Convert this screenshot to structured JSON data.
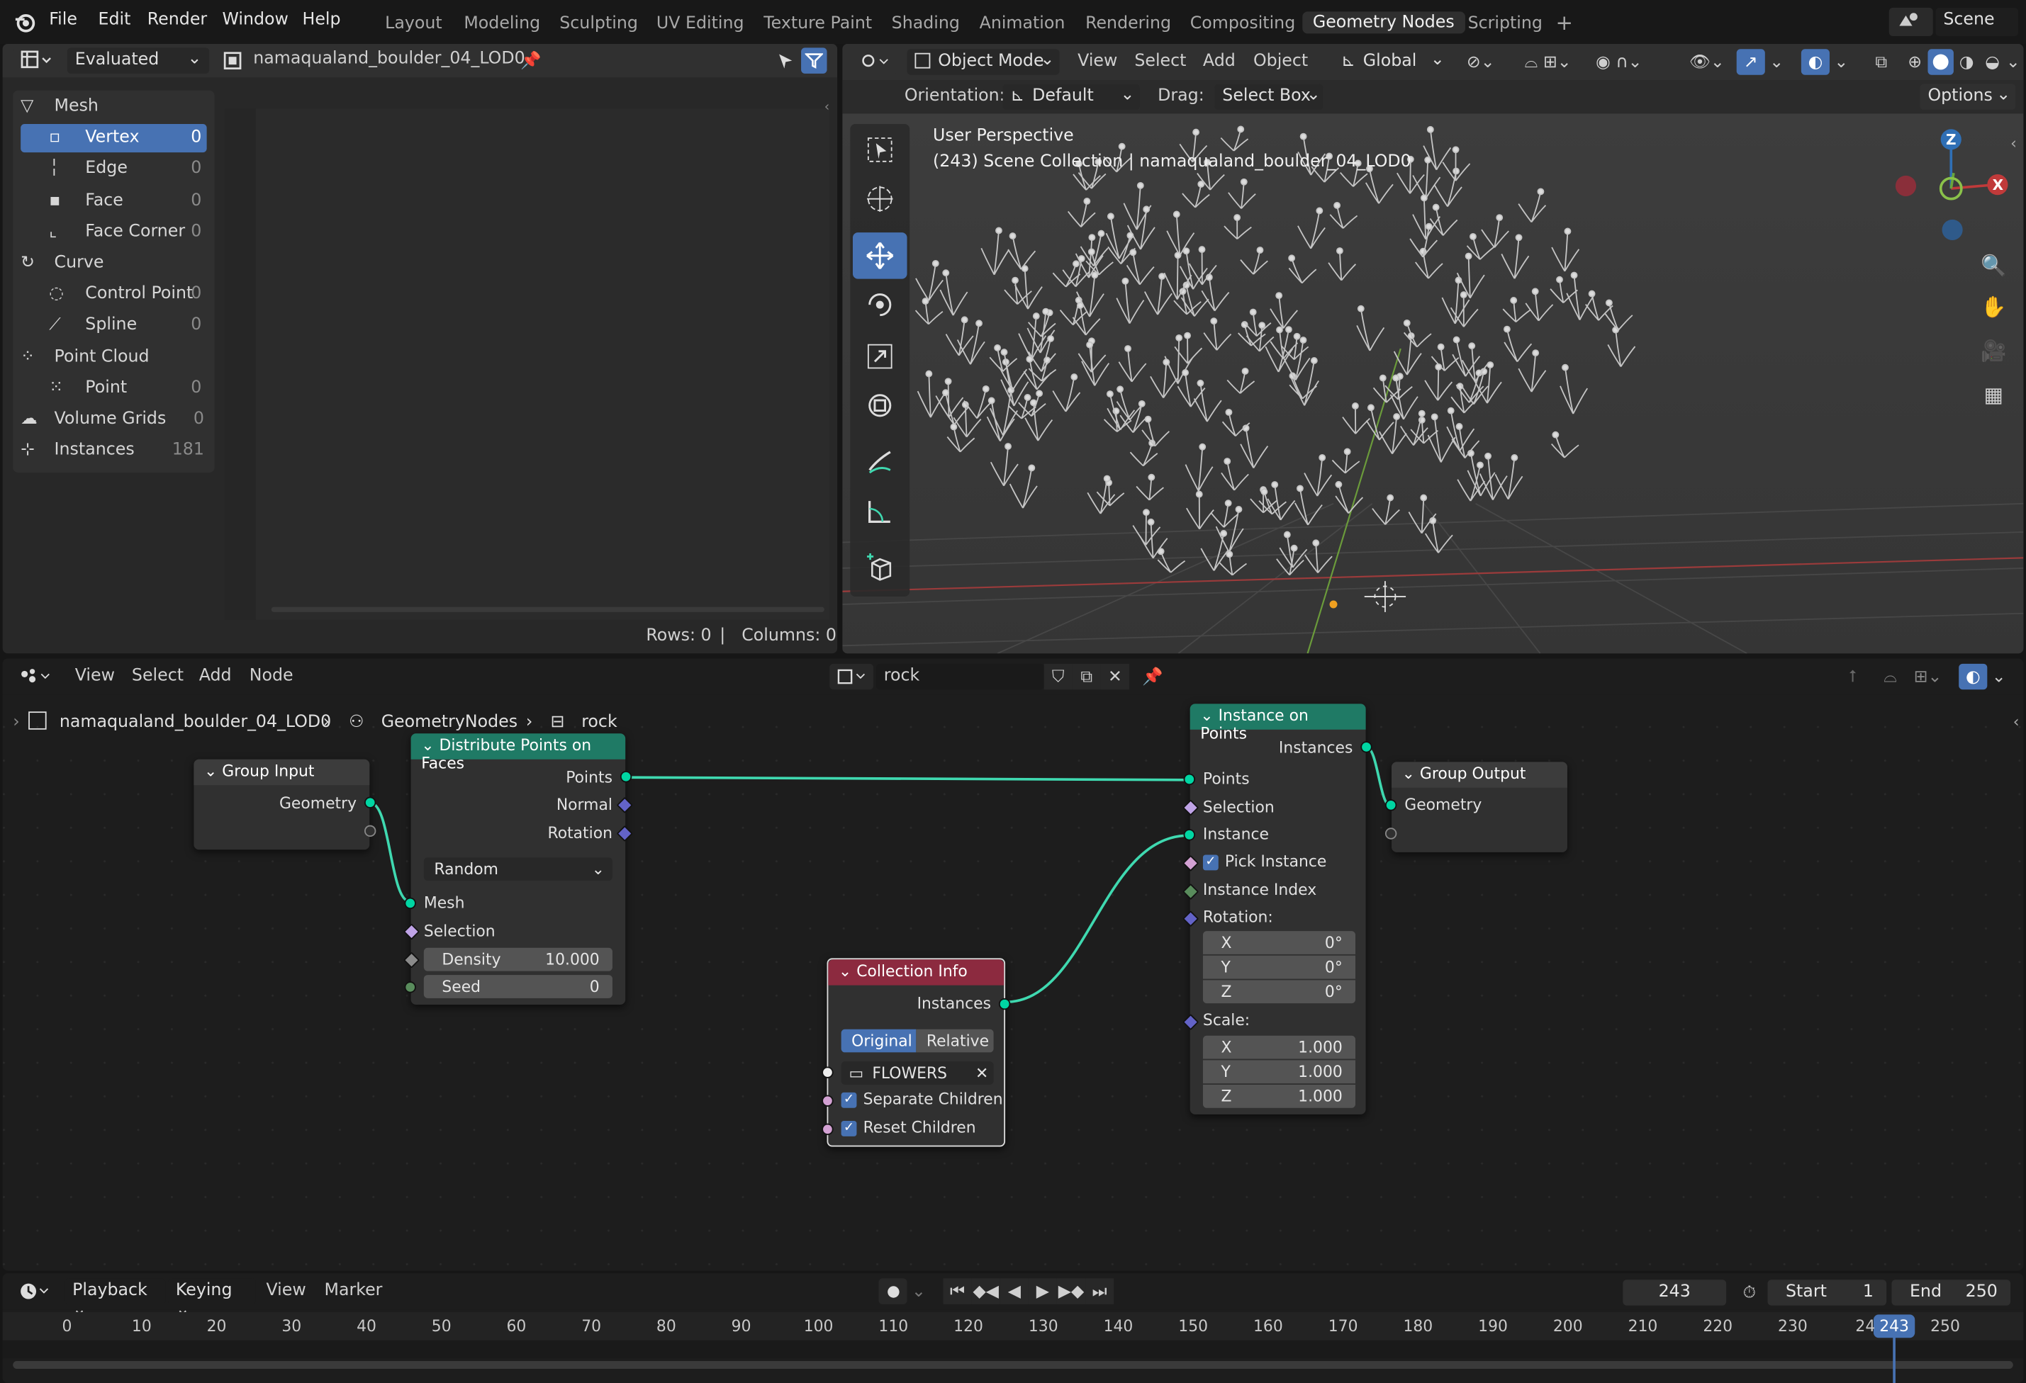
{
  "topbar": {
    "menu": [
      "File",
      "Edit",
      "Render",
      "Window",
      "Help"
    ],
    "workspaces": [
      "Layout",
      "Modeling",
      "Sculpting",
      "UV Editing",
      "Texture Paint",
      "Shading",
      "Animation",
      "Rendering",
      "Compositing",
      "Geometry Nodes",
      "Scripting"
    ],
    "active_workspace": "Geometry Nodes",
    "scene": "Scene"
  },
  "spreadsheet": {
    "mode": "Evaluated",
    "object": "namaqualand_boulder_04_LOD0",
    "tree": [
      {
        "label": "Mesh",
        "count": "",
        "level": 0
      },
      {
        "label": "Vertex",
        "count": "0",
        "level": 1,
        "selected": true
      },
      {
        "label": "Edge",
        "count": "0",
        "level": 1
      },
      {
        "label": "Face",
        "count": "0",
        "level": 1
      },
      {
        "label": "Face Corner",
        "count": "0",
        "level": 1
      },
      {
        "label": "Curve",
        "count": "",
        "level": 0
      },
      {
        "label": "Control Point",
        "count": "0",
        "level": 1
      },
      {
        "label": "Spline",
        "count": "0",
        "level": 1
      },
      {
        "label": "Point Cloud",
        "count": "",
        "level": 0
      },
      {
        "label": "Point",
        "count": "0",
        "level": 1
      },
      {
        "label": "Volume Grids",
        "count": "0",
        "level": 0
      },
      {
        "label": "Instances",
        "count": "181",
        "level": 0
      }
    ],
    "rows": "Rows: 0",
    "sep": "|",
    "columns": "Columns: 0"
  },
  "viewport": {
    "mode": "Object Mode",
    "menus": [
      "View",
      "Select",
      "Add",
      "Object"
    ],
    "transform": "Global",
    "orientation_label": "Orientation:",
    "orientation_value": "Default",
    "drag_label": "Drag:",
    "drag_value": "Select Box",
    "options": "Options",
    "persp": "User Perspective",
    "collection": "(243) Scene Collection | namaqualand_boulder_04_LOD0",
    "gizmo": {
      "z": "Z",
      "x": "X"
    }
  },
  "node_editor": {
    "menus": [
      "View",
      "Select",
      "Add",
      "Node"
    ],
    "tree_name": "rock",
    "breadcrumb": [
      "namaqualand_boulder_04_LOD0",
      "GeometryNodes",
      "rock"
    ],
    "nodes": {
      "group_input": {
        "title": "Group Input",
        "out": "Geometry"
      },
      "distribute": {
        "title": "Distribute Points on Faces",
        "out_points": "Points",
        "out_normal": "Normal",
        "out_rotation": "Rotation",
        "mode": "Random",
        "in_mesh": "Mesh",
        "in_selection": "Selection",
        "density_label": "Density",
        "density_value": "10.000",
        "seed_label": "Seed",
        "seed_value": "0"
      },
      "collection_info": {
        "title": "Collection Info",
        "out": "Instances",
        "opt_original": "Original",
        "opt_relative": "Relative",
        "collection": "FLOWERS",
        "separate": "Separate Children",
        "reset": "Reset Children"
      },
      "instance_on_points": {
        "title": "Instance on Points",
        "out": "Instances",
        "in_points": "Points",
        "in_selection": "Selection",
        "in_instance": "Instance",
        "pick": "Pick Instance",
        "index": "Instance Index",
        "rotation": "Rotation:",
        "rot_x": "0°",
        "rot_y": "0°",
        "rot_z": "0°",
        "scale": "Scale:",
        "sc_x": "1.000",
        "sc_y": "1.000",
        "sc_z": "1.000",
        "ax_x": "X",
        "ax_y": "Y",
        "ax_z": "Z"
      },
      "group_output": {
        "title": "Group Output",
        "in": "Geometry"
      }
    },
    "colors": {
      "geometry_header": "#1f7a65",
      "input_header": "#3c3c3c",
      "collection_header": "#8c2a3f",
      "link": "#3fd9b0"
    }
  },
  "timeline": {
    "playback": "Playback",
    "keying": "Keying",
    "view": "View",
    "marker": "Marker",
    "current_frame": "243",
    "start_label": "Start",
    "start": "1",
    "end_label": "End",
    "end": "250",
    "ticks": [
      "0",
      "10",
      "20",
      "30",
      "40",
      "50",
      "60",
      "70",
      "80",
      "90",
      "100",
      "110",
      "120",
      "130",
      "140",
      "150",
      "160",
      "170",
      "180",
      "190",
      "200",
      "210",
      "220",
      "230",
      "24",
      "250"
    ],
    "playhead": "243"
  }
}
